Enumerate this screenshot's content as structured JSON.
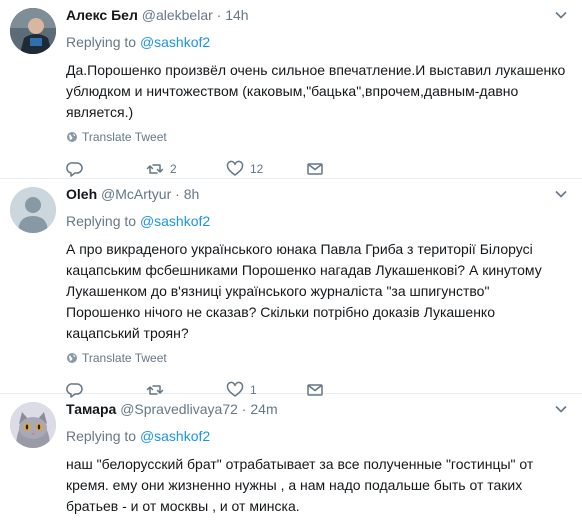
{
  "tweets": [
    {
      "name": "Алекс Бел",
      "handle": "@alekbelar",
      "sep": " · ",
      "time": "14h",
      "replying_label": "Replying to ",
      "replying_to": "@sashkof2",
      "text": "Да.Порошенко произвёл очень сильное впечатление.И выставил лукашенко\nублюдком и ничтожеством (каковым,\"бацька\",впрочем,давным-давно\nявляется.)",
      "translate": "Translate Tweet",
      "retweets": "2",
      "likes": "12"
    },
    {
      "name": "Oleh",
      "handle": "@McArtyur",
      "sep": " · ",
      "time": "8h",
      "replying_label": "Replying to ",
      "replying_to": "@sashkof2",
      "text": "А про викраденого українського юнака Павла Гриба з території Білорусі\nкацапським фсбешниками Порошенко нагадав Лукашенкові? А кинутому\nЛукашенком до в'язниці українського журналіста \"за шпигунство\"\nПорошенко нічого не сказав? Скільки потрібно доказів Лукашенко\nкацапський троян?",
      "translate": "Translate Tweet",
      "retweets": "",
      "likes": "1"
    },
    {
      "name": "Тамара",
      "handle": "@Spravedlivaya72",
      "sep": " · ",
      "time": "24m",
      "replying_label": "Replying to ",
      "replying_to": "@sashkof2",
      "text": "наш \"белорусский брат\" отрабатывает  за все полученные \"гостинцы\" от\nкремя.  ему они жизненно нужны , а нам надо подальше быть от таких\nбратьев - и от москвы , и от минска."
    }
  ],
  "colors": {
    "link": "#1b95e0",
    "muted": "#657786",
    "text": "#14171a",
    "divider": "#e6ecf0"
  },
  "icons": [
    "caret-down-icon",
    "globe-icon",
    "reply-icon",
    "retweet-icon",
    "like-icon",
    "message-icon"
  ]
}
